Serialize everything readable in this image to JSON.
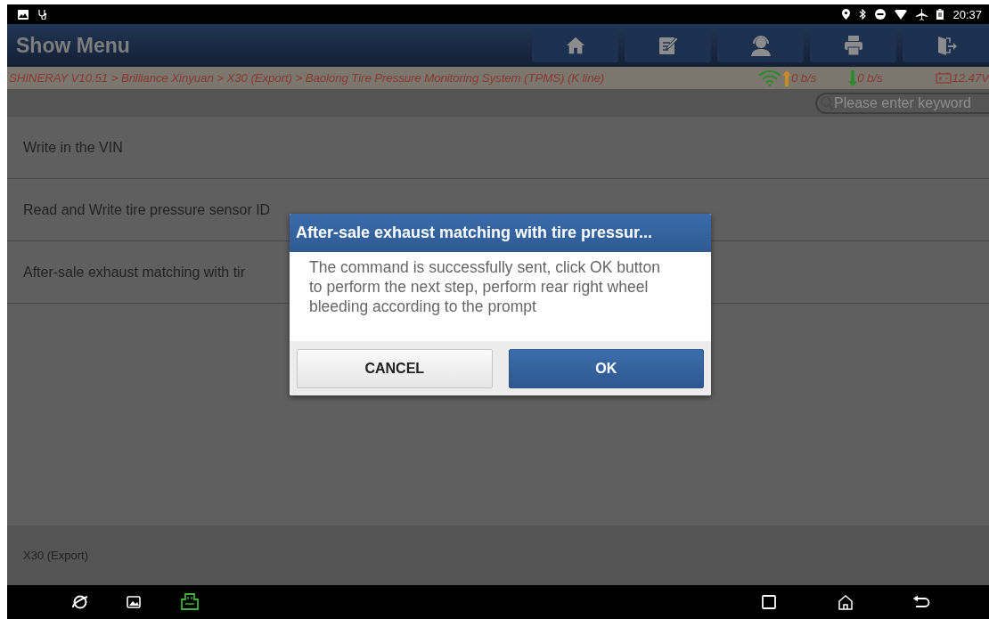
{
  "status_bar": {
    "time": "20:37"
  },
  "header": {
    "title": "Show Menu",
    "buttons": [
      {
        "kind": "home"
      },
      {
        "kind": "edit"
      },
      {
        "kind": "support"
      },
      {
        "kind": "print"
      },
      {
        "kind": "exit"
      }
    ]
  },
  "breadcrumb": "SHINERAY V10.51 > Brilliance Xinyuan > X30 (Export) > Baolong Tire Pressure Monitoring System (TPMS) (K line)",
  "connection": {
    "upload": "0 b/s",
    "download": "0 b/s",
    "voltage": "12.47V"
  },
  "search": {
    "placeholder": "Please enter keyword"
  },
  "menu_items": [
    {
      "label": "Write in the VIN"
    },
    {
      "label": "Read and Write tire pressure sensor ID"
    },
    {
      "label": "After-sale exhaust matching with tir"
    }
  ],
  "footer": {
    "label": "X30 (Export)"
  },
  "dialog": {
    "title": "After-sale exhaust matching with tire pressur...",
    "message": "The command is successfully sent, click OK button to perform the next step, perform rear right wheel bleeding according to the prompt",
    "buttons": [
      {
        "label": "CANCEL",
        "kind": "secondary"
      },
      {
        "label": "OK",
        "kind": "primary"
      }
    ]
  }
}
